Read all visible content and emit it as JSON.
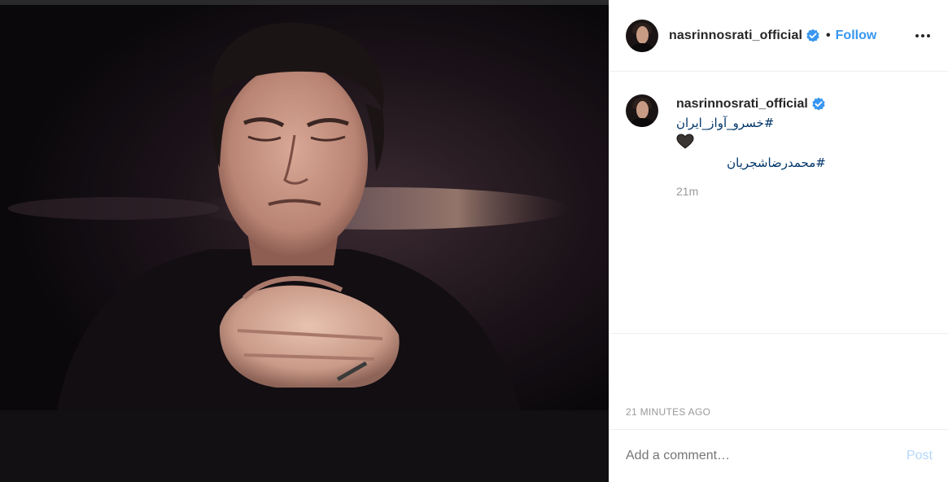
{
  "header": {
    "username": "nasrinnosrati_official",
    "separator": "•",
    "follow_label": "Follow"
  },
  "caption": {
    "username": "nasrinnosrati_official",
    "lines": [
      "#خسرو_آواز_ایران",
      "#محمدرضاشجریان"
    ],
    "time_short": "21m"
  },
  "footer": {
    "timestamp": "21 MINUTES AGO",
    "comment_placeholder": "Add a comment…",
    "post_label": "Post"
  },
  "icons": {
    "verified": "verified-badge-icon",
    "more": "more-options-icon",
    "heart": "black-heart-emoji"
  },
  "colors": {
    "link_blue": "#3897f0",
    "hashtag_blue": "#003569",
    "muted": "#999999",
    "post_disabled": "#b3d7fa"
  }
}
